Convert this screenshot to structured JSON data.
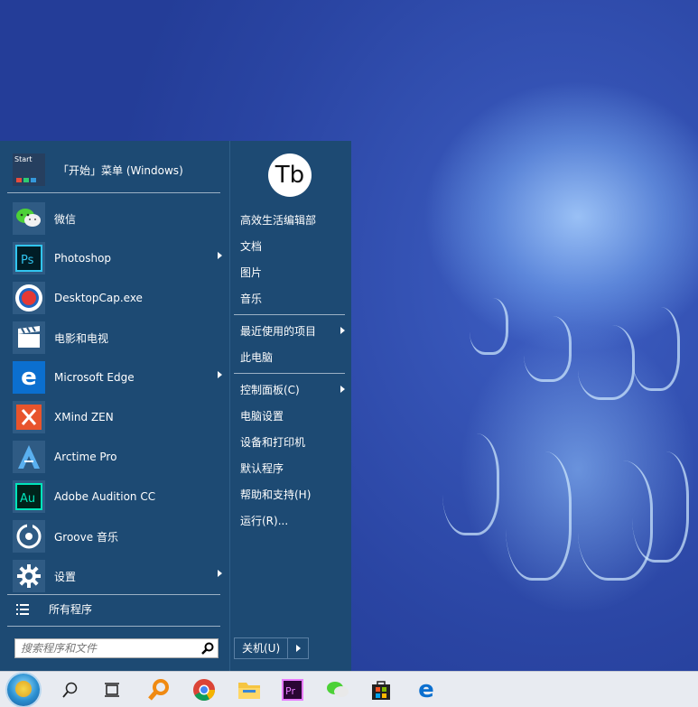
{
  "start_menu": {
    "pinned": {
      "logo_text": "Start",
      "title": "「开始」菜单 (Windows)"
    },
    "apps": [
      {
        "label": "微信",
        "icon": "wechat-icon",
        "has_submenu": false
      },
      {
        "label": "Photoshop",
        "icon": "photoshop-icon",
        "has_submenu": true
      },
      {
        "label": "DesktopCap.exe",
        "icon": "desktopcap-icon",
        "has_submenu": false
      },
      {
        "label": "电影和电视",
        "icon": "movies-tv-icon",
        "has_submenu": false
      },
      {
        "label": "Microsoft Edge",
        "icon": "edge-icon",
        "has_submenu": true
      },
      {
        "label": "XMind ZEN",
        "icon": "xmind-icon",
        "has_submenu": false
      },
      {
        "label": "Arctime Pro",
        "icon": "arctime-icon",
        "has_submenu": false
      },
      {
        "label": "Adobe Audition CC",
        "icon": "audition-icon",
        "has_submenu": false
      },
      {
        "label": "Groove 音乐",
        "icon": "groove-icon",
        "has_submenu": false
      },
      {
        "label": "设置",
        "icon": "settings-gear-icon",
        "has_submenu": true
      }
    ],
    "all_programs": "所有程序",
    "search": {
      "placeholder": "搜索程序和文件"
    },
    "user": {
      "avatar_text": "Tb"
    },
    "right_items": [
      {
        "label": "高效生活编辑部"
      },
      {
        "label": "文档"
      },
      {
        "label": "图片"
      },
      {
        "label": "音乐"
      },
      {
        "label": "最近使用的项目",
        "has_submenu": true
      },
      {
        "label": "此电脑"
      },
      {
        "label": "控制面板(C)",
        "has_submenu": true
      },
      {
        "label": "电脑设置"
      },
      {
        "label": "设备和打印机"
      },
      {
        "label": "默认程序"
      },
      {
        "label": "帮助和支持(H)"
      },
      {
        "label": "运行(R)..."
      }
    ],
    "shutdown": {
      "label": "关机(U)"
    }
  },
  "taskbar": {
    "items": [
      "start-orb-icon",
      "search-icon",
      "task-view-icon",
      "everything-search-icon",
      "chrome-icon",
      "file-explorer-icon",
      "premiere-icon",
      "wechat-icon",
      "store-icon",
      "edge-icon"
    ]
  },
  "colors": {
    "menu_bg": "#1d4a73",
    "taskbar_bg": "#e8ebf1",
    "desktop_bg": "#2e4aa6"
  }
}
